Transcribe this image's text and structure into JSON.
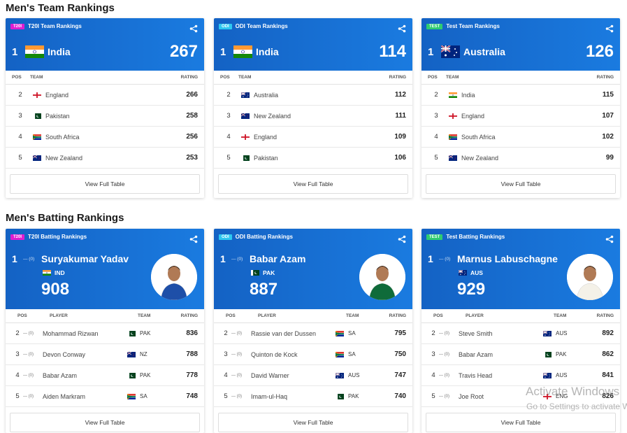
{
  "team_section": {
    "title": "Men's Team Rankings",
    "cards": [
      {
        "badge": "T20I",
        "badge_color": "#e01dd0",
        "title": "T20I Team Rankings",
        "leader": {
          "rank": "1",
          "team": "India",
          "flag": "IND",
          "rating": "267"
        },
        "columns": {
          "pos": "POS",
          "team": "TEAM",
          "rating": "RATING"
        },
        "rows": [
          {
            "pos": "2",
            "team": "England",
            "flag": "ENG",
            "rating": "266"
          },
          {
            "pos": "3",
            "team": "Pakistan",
            "flag": "PAK",
            "rating": "258"
          },
          {
            "pos": "4",
            "team": "South Africa",
            "flag": "SA",
            "rating": "256"
          },
          {
            "pos": "5",
            "team": "New Zealand",
            "flag": "NZ",
            "rating": "253"
          }
        ],
        "button": "View Full Table"
      },
      {
        "badge": "ODI",
        "badge_color": "#2ec8f0",
        "title": "ODI Team Rankings",
        "leader": {
          "rank": "1",
          "team": "India",
          "flag": "IND",
          "rating": "114"
        },
        "columns": {
          "pos": "POS",
          "team": "TEAM",
          "rating": "RATING"
        },
        "rows": [
          {
            "pos": "2",
            "team": "Australia",
            "flag": "AUS",
            "rating": "112"
          },
          {
            "pos": "3",
            "team": "New Zealand",
            "flag": "NZ",
            "rating": "111"
          },
          {
            "pos": "4",
            "team": "England",
            "flag": "ENG",
            "rating": "109"
          },
          {
            "pos": "5",
            "team": "Pakistan",
            "flag": "PAK",
            "rating": "106"
          }
        ],
        "button": "View Full Table"
      },
      {
        "badge": "TEST",
        "badge_color": "#2ecc71",
        "title": "Test Team Rankings",
        "leader": {
          "rank": "1",
          "team": "Australia",
          "flag": "AUS",
          "rating": "126"
        },
        "columns": {
          "pos": "POS",
          "team": "TEAM",
          "rating": "RATING"
        },
        "rows": [
          {
            "pos": "2",
            "team": "India",
            "flag": "IND",
            "rating": "115"
          },
          {
            "pos": "3",
            "team": "England",
            "flag": "ENG",
            "rating": "107"
          },
          {
            "pos": "4",
            "team": "South Africa",
            "flag": "SA",
            "rating": "102"
          },
          {
            "pos": "5",
            "team": "New Zealand",
            "flag": "NZ",
            "rating": "99"
          }
        ],
        "button": "View Full Table"
      }
    ]
  },
  "batting_section": {
    "title": "Men's Batting Rankings",
    "cards": [
      {
        "badge": "T20I",
        "badge_color": "#e01dd0",
        "title": "T20I Batting Rankings",
        "leader": {
          "rank": "1",
          "move": "— (0)",
          "name": "Suryakumar Yadav",
          "country": "IND",
          "flag": "IND",
          "rating": "908",
          "kit_color": "#1e4fa8"
        },
        "columns": {
          "pos": "POS",
          "player": "PLAYER",
          "team": "TEAM",
          "rating": "RATING"
        },
        "rows": [
          {
            "pos": "2",
            "move": "— (0)",
            "player": "Mohammad Rizwan",
            "team": "PAK",
            "flag": "PAK",
            "rating": "836"
          },
          {
            "pos": "3",
            "move": "— (0)",
            "player": "Devon Conway",
            "team": "NZ",
            "flag": "NZ",
            "rating": "788"
          },
          {
            "pos": "4",
            "move": "— (0)",
            "player": "Babar Azam",
            "team": "PAK",
            "flag": "PAK",
            "rating": "778"
          },
          {
            "pos": "5",
            "move": "— (0)",
            "player": "Aiden Markram",
            "team": "SA",
            "flag": "SA",
            "rating": "748"
          }
        ],
        "button": "View Full Table"
      },
      {
        "badge": "ODI",
        "badge_color": "#2ec8f0",
        "title": "ODI Batting Rankings",
        "leader": {
          "rank": "1",
          "move": "— (0)",
          "name": "Babar Azam",
          "country": "PAK",
          "flag": "PAK",
          "rating": "887",
          "kit_color": "#0f6b3a"
        },
        "columns": {
          "pos": "POS",
          "player": "PLAYER",
          "team": "TEAM",
          "rating": "RATING"
        },
        "rows": [
          {
            "pos": "2",
            "move": "— (0)",
            "player": "Rassie van der Dussen",
            "team": "SA",
            "flag": "SA",
            "rating": "795"
          },
          {
            "pos": "3",
            "move": "— (0)",
            "player": "Quinton de Kock",
            "team": "SA",
            "flag": "SA",
            "rating": "750"
          },
          {
            "pos": "4",
            "move": "— (0)",
            "player": "David Warner",
            "team": "AUS",
            "flag": "AUS",
            "rating": "747"
          },
          {
            "pos": "5",
            "move": "— (0)",
            "player": "Imam-ul-Haq",
            "team": "PAK",
            "flag": "PAK",
            "rating": "740"
          }
        ],
        "button": "View Full Table"
      },
      {
        "badge": "TEST",
        "badge_color": "#2ecc71",
        "title": "Test Batting Rankings",
        "leader": {
          "rank": "1",
          "move": "— (0)",
          "name": "Marnus Labuschagne",
          "country": "AUS",
          "flag": "AUS",
          "rating": "929",
          "kit_color": "#f4f1e8"
        },
        "columns": {
          "pos": "POS",
          "player": "PLAYER",
          "team": "TEAM",
          "rating": "RATING"
        },
        "rows": [
          {
            "pos": "2",
            "move": "— (0)",
            "player": "Steve Smith",
            "team": "AUS",
            "flag": "AUS",
            "rating": "892"
          },
          {
            "pos": "3",
            "move": "— (0)",
            "player": "Babar Azam",
            "team": "PAK",
            "flag": "PAK",
            "rating": "862"
          },
          {
            "pos": "4",
            "move": "— (0)",
            "player": "Travis Head",
            "team": "AUS",
            "flag": "AUS",
            "rating": "841"
          },
          {
            "pos": "5",
            "move": "— (0)",
            "player": "Joe Root",
            "team": "ENG",
            "flag": "ENG",
            "rating": "826"
          }
        ],
        "button": "View Full Table"
      }
    ]
  },
  "watermark": {
    "line1": "Activate Windows",
    "line2": "Go to Settings to activate Windows."
  }
}
